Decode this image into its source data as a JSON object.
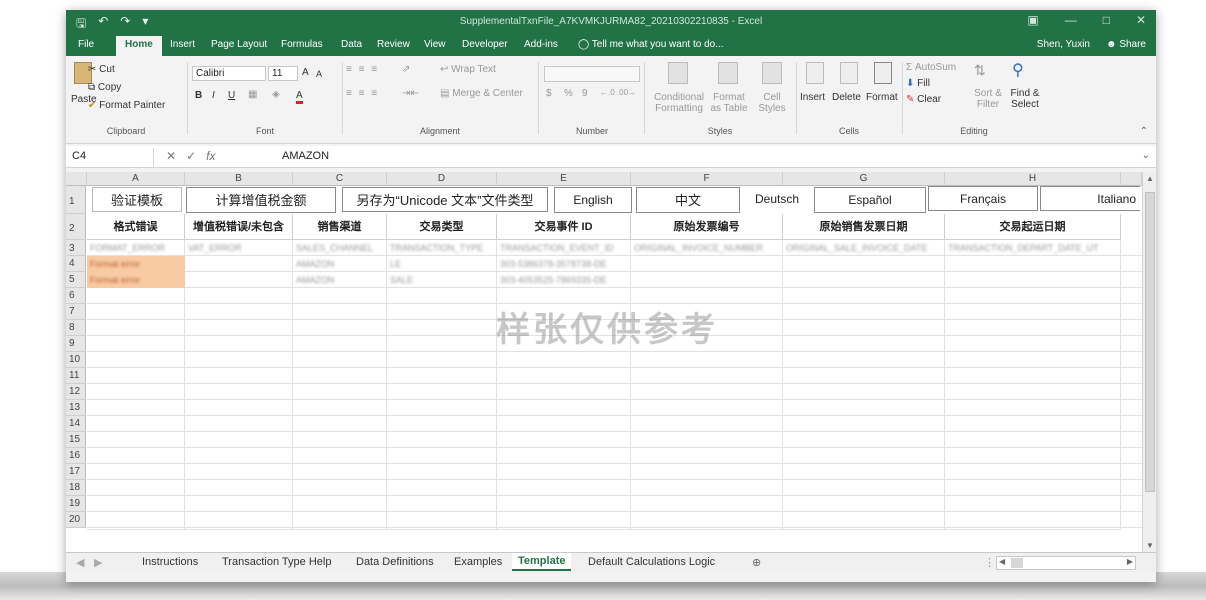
{
  "window": {
    "title": "SupplementalTxnFile_A7KVMKJURMA82_20210302210835 - Excel",
    "user": "Shen, Yuxin",
    "share_label": "Share"
  },
  "menu": {
    "tabs": [
      "File",
      "Home",
      "Insert",
      "Page Layout",
      "Formulas",
      "Data",
      "Review",
      "View",
      "Developer",
      "Add-ins"
    ],
    "tell_me": "Tell me what you want to do..."
  },
  "ribbon": {
    "clipboard": {
      "paste": "Paste",
      "cut": "Cut",
      "copy": "Copy",
      "format_painter": "Format Painter",
      "label": "Clipboard"
    },
    "font": {
      "name": "Calibri",
      "size": "11",
      "bold": "B",
      "italic": "I",
      "underline": "U",
      "grow": "A",
      "shrink": "A",
      "font_color": "A",
      "label": "Font"
    },
    "alignment": {
      "wrap": "Wrap Text",
      "merge": "Merge & Center",
      "label": "Alignment"
    },
    "number": {
      "currency": "$",
      "percent": "%",
      "comma": "9",
      "label": "Number"
    },
    "styles": {
      "conditional": "Conditional Formatting",
      "format_table": "Format as Table",
      "cell_styles": "Cell Styles",
      "label": "Styles"
    },
    "cells": {
      "insert": "Insert",
      "delete": "Delete",
      "format": "Format",
      "label": "Cells"
    },
    "editing": {
      "autosum": "AutoSum",
      "fill": "Fill",
      "clear": "Clear",
      "sort": "Sort & Filter",
      "find": "Find & Select",
      "label": "Editing"
    }
  },
  "formula_bar": {
    "name_box": "C4",
    "fx": "fx",
    "value": "AMAZON"
  },
  "columns": [
    "A",
    "B",
    "C",
    "D",
    "E",
    "F",
    "G",
    "H"
  ],
  "rows": [
    "1",
    "2",
    "3",
    "4",
    "5",
    "6",
    "7",
    "8",
    "9",
    "10",
    "11",
    "12",
    "13",
    "14",
    "15",
    "16",
    "17",
    "18",
    "19",
    "20"
  ],
  "row1": {
    "validate": "验证模板",
    "calc": "计算增值税金额",
    "save_as": "另存为“Unicode 文本”文件类型",
    "languages": [
      "English",
      "中文",
      "Deutsch",
      "Español",
      "Français",
      "Italiano"
    ]
  },
  "row2_headers": [
    "格式错误",
    "增值税错误/未包含",
    "销售渠道",
    "交易类型",
    "交易事件 ID",
    "原始发票编号",
    "原始销售发票日期",
    "交易起运日期"
  ],
  "row3_fields": [
    "FORMAT_ERROR",
    "VAT_ERROR",
    "SALES_CHANNEL",
    "TRANSACTION_TYPE",
    "TRANSACTION_EVENT_ID",
    "ORIGINAL_INVOICE_NUMBER",
    "ORIGINAL_SALE_INVOICE_DATE",
    "TRANSACTION_DEPART_DATE_UT"
  ],
  "data_rows": [
    {
      "error": "Format error",
      "channel": "AMAZON",
      "type": "LE",
      "event_id": "303-5386378-3578738-DE"
    },
    {
      "error": "Format error",
      "channel": "AMAZON",
      "type": "SALE",
      "event_id": "303-4053525-7869335-DE"
    }
  ],
  "watermark": "样张仅供参考",
  "sheet_tabs": [
    "Instructions",
    "Transaction Type Help",
    "Data Definitions",
    "Examples",
    "Template",
    "Default Calculations Logic"
  ],
  "active_sheet": "Template",
  "colors": {
    "excel_green": "#217346",
    "error_fill": "#f8cba4"
  }
}
